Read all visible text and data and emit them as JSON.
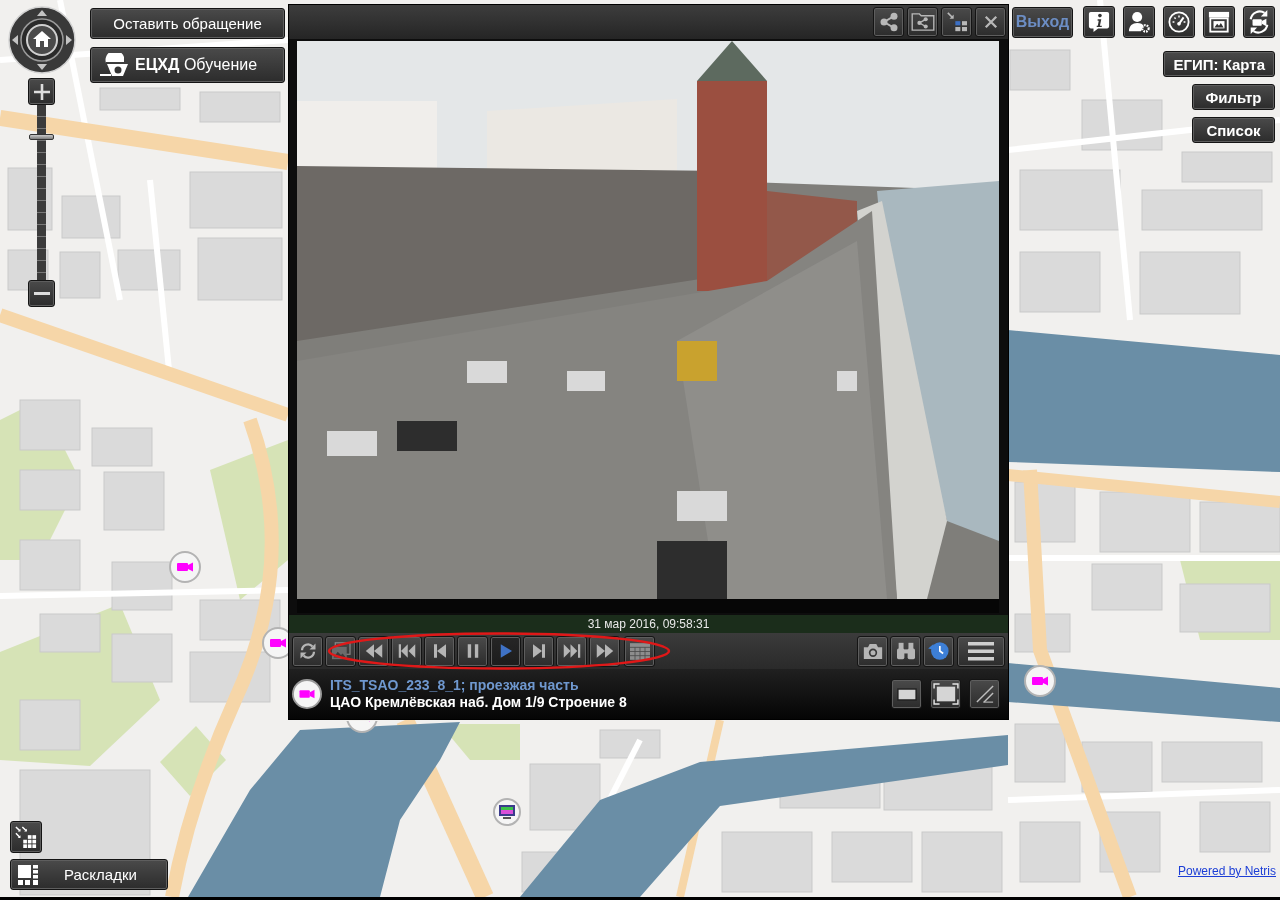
{
  "top_left": {
    "appeal_button": "Оставить обращение",
    "training_button": "**ЕЦХД** Обучение"
  },
  "zoom": {
    "level": 0.83
  },
  "player": {
    "timestamp": "31 мар 2016, 09:58:31",
    "playback_controls": [
      {
        "kind": "refresh",
        "selected": false
      },
      {
        "kind": "gallery",
        "selected": false
      },
      {
        "kind": "rewind",
        "selected": false
      },
      {
        "kind": "skip_back",
        "selected": false
      },
      {
        "kind": "step_back",
        "selected": false
      },
      {
        "kind": "pause",
        "selected": false
      },
      {
        "kind": "play",
        "selected": true
      },
      {
        "kind": "step_forward",
        "selected": false
      },
      {
        "kind": "skip_forward",
        "selected": false
      },
      {
        "kind": "fast_forward",
        "selected": false
      },
      {
        "kind": "calendar",
        "selected": false
      }
    ],
    "camera": {
      "name": "ITS_TSAO_233_8_1; проезжая часть",
      "address": "ЦАО Кремлёвская наб. Дом 1/9 Строение 8"
    }
  },
  "top_right": {
    "exit_button": "Выход",
    "buttons": [
      "ЕГИП: Карта",
      "Фильтр",
      "Список"
    ]
  },
  "layouts_button": "Раскладки",
  "footer_link": "Powered by Netris",
  "annotations": [
    {
      "kind": "ellipse"
    }
  ]
}
